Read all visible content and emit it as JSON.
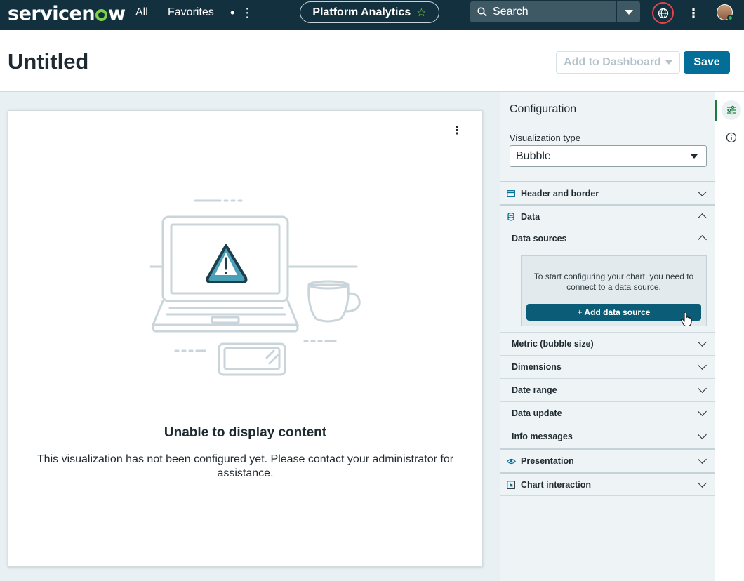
{
  "nav": {
    "logo_pre": "servicen",
    "logo_post": "w",
    "all": "All",
    "favorites": "Favorites",
    "more": "• ⋮",
    "pill_label": "Platform Analytics",
    "search_placeholder": "Search"
  },
  "header": {
    "title": "Untitled",
    "add_to_dashboard": "Add to Dashboard",
    "save": "Save"
  },
  "canvas": {
    "error_title": "Unable to display content",
    "error_message": "This visualization has not been configured yet. Please contact your administrator for assistance."
  },
  "config": {
    "title": "Configuration",
    "viz_type_label": "Visualization type",
    "viz_type_value": "Bubble",
    "sections": {
      "header_border": "Header and border",
      "data": "Data",
      "data_sources": "Data sources",
      "data_sources_hint": "To start configuring your chart, you need to connect to a data source.",
      "add_data_source": "+ Add data source",
      "metric": "Metric (bubble size)",
      "dimensions": "Dimensions",
      "date_range": "Date range",
      "data_update": "Data update",
      "info_messages": "Info messages",
      "presentation": "Presentation",
      "chart_interaction": "Chart interaction"
    }
  },
  "colors": {
    "nav_bg": "#12303d",
    "accent_green": "#7fd24b",
    "primary_button": "#036e97"
  }
}
